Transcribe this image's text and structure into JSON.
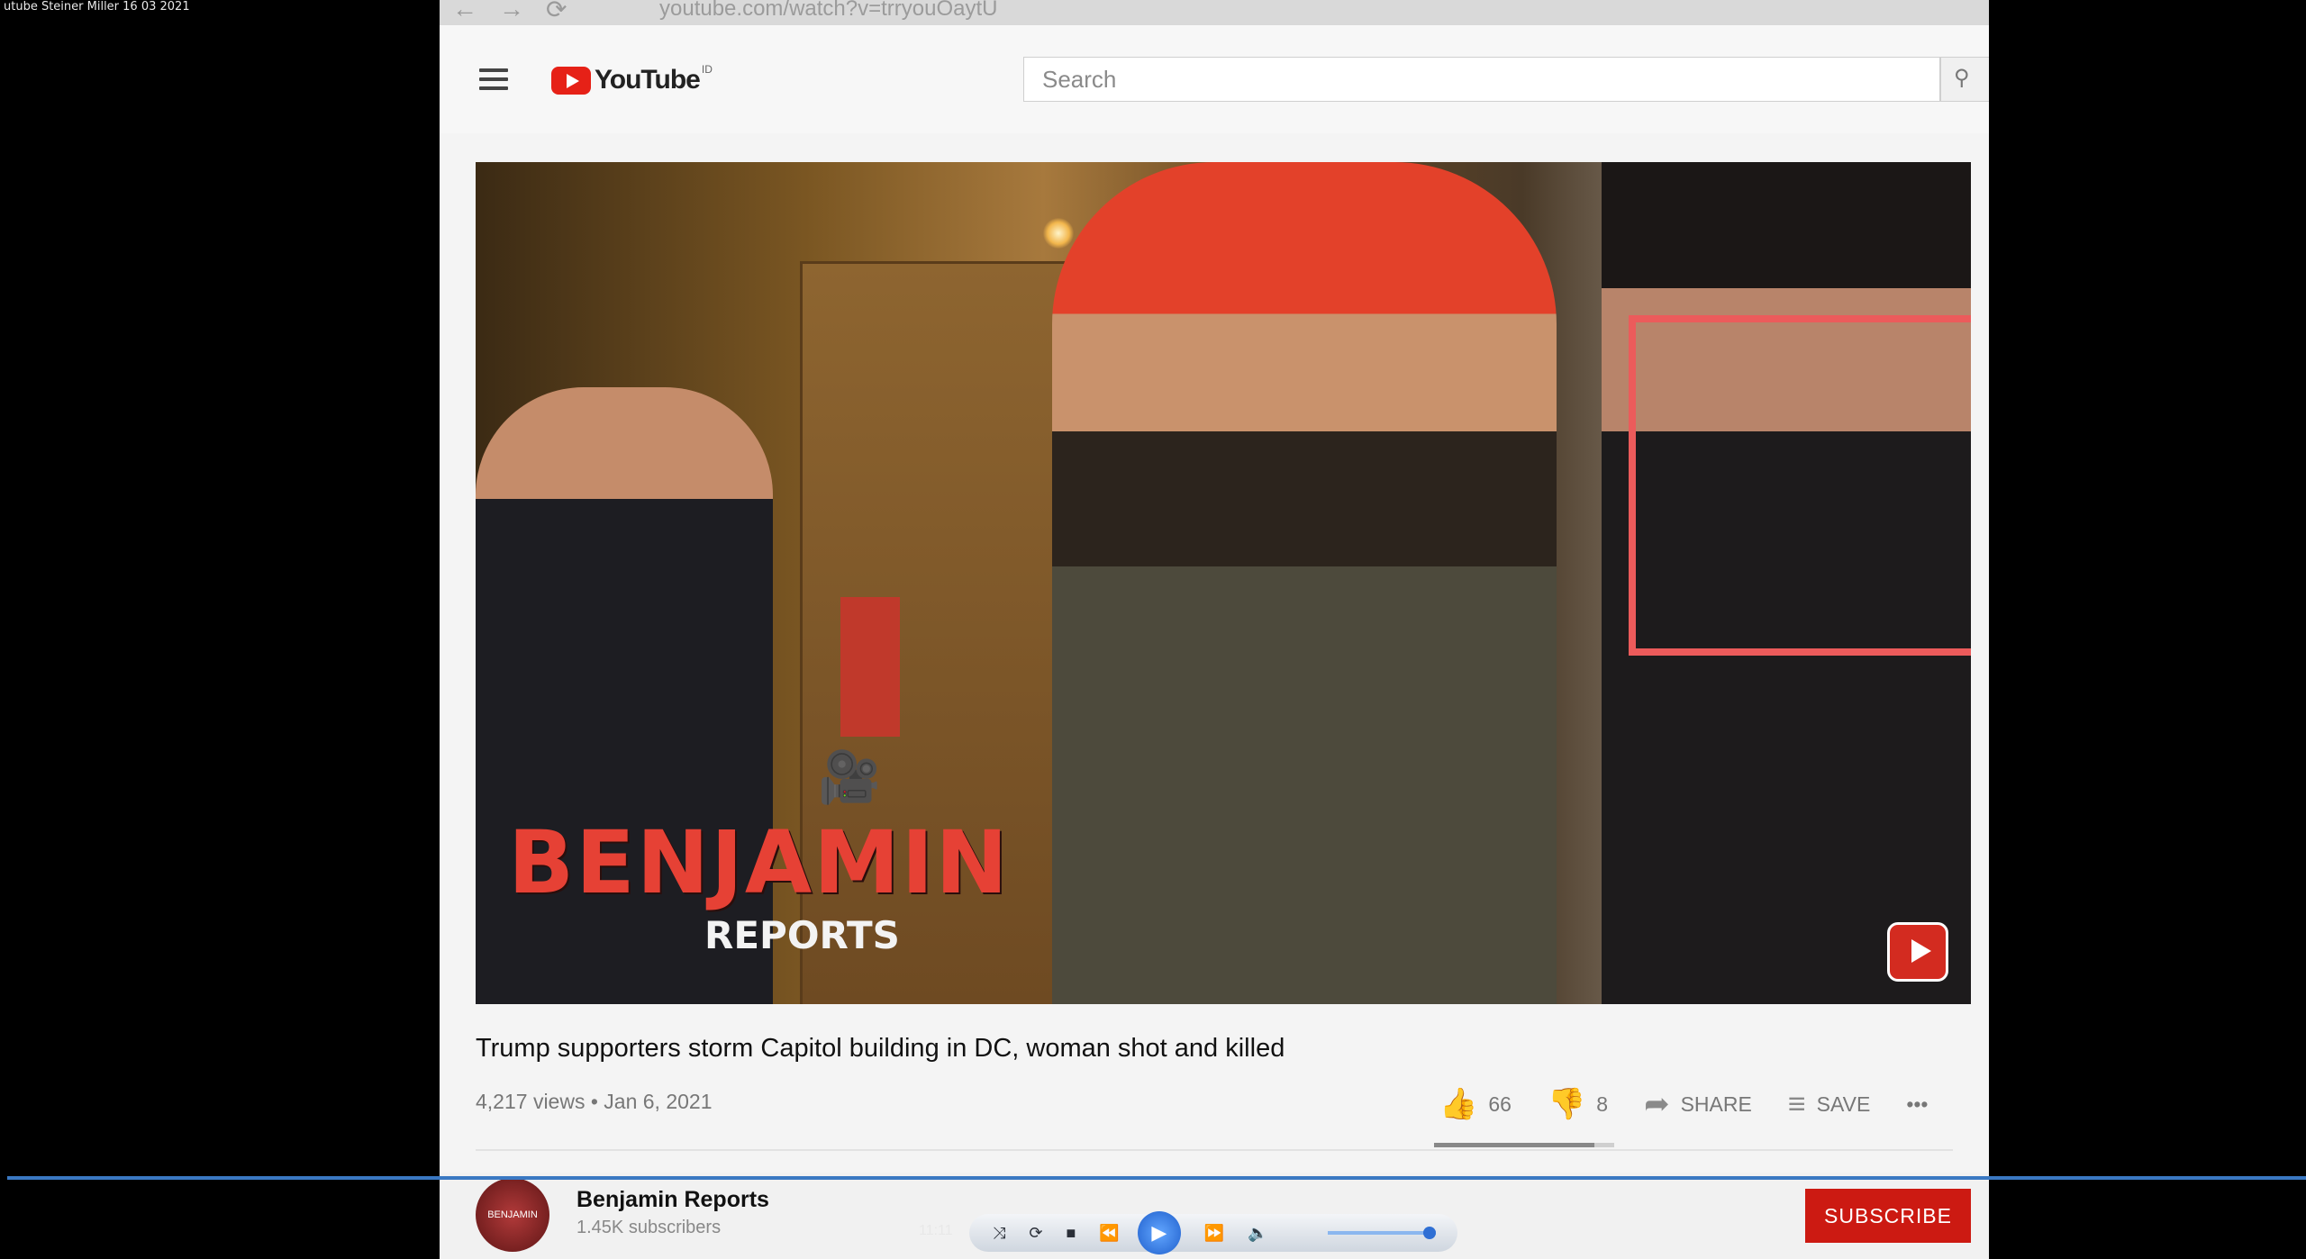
{
  "caption": "utube Steiner Miller 16 03 2021",
  "browser": {
    "nav_back": "←",
    "nav_forward": "→",
    "nav_reload": "⟳",
    "url": "youtube.com/watch?v=trryouOaytU"
  },
  "header": {
    "logo_text": "YouTube",
    "logo_sup": "ID",
    "search_placeholder": "Search",
    "search_icon": "search-icon"
  },
  "video": {
    "watermark_main": "BENJAMIN",
    "watermark_sub": "REPORTS"
  },
  "info": {
    "title": "Trump supporters storm Capitol building in DC, woman shot and killed",
    "meta": "4,217 views • Jan 6, 2021",
    "likes": "66",
    "dislikes": "8",
    "share_label": "SHARE",
    "save_label": "SAVE",
    "more_label": "•••",
    "like_ratio": 0.89
  },
  "channel": {
    "avatar_text": "BENJAMIN",
    "name": "Benjamin Reports",
    "subscribers": "1.45K subscribers",
    "subscribe_label": "SUBSCRIBE"
  },
  "player": {
    "time": "11:11"
  },
  "colors": {
    "highlight": "#ec5b5b",
    "brand": "#e62117",
    "subscribe": "#cc1a12"
  }
}
